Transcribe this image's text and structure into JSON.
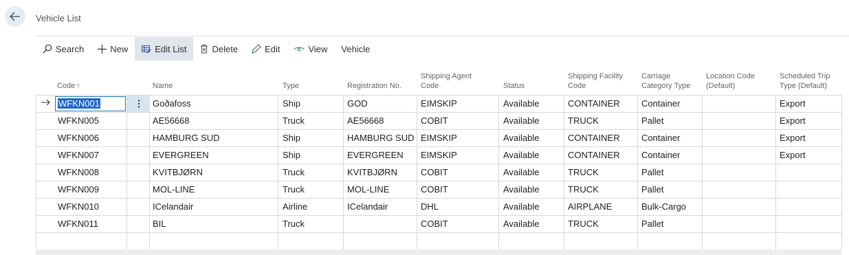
{
  "page": {
    "title": "Vehicle List"
  },
  "toolbar": {
    "search": "Search",
    "new": "New",
    "edit_list": "Edit List",
    "delete": "Delete",
    "edit": "Edit",
    "view": "View",
    "vehicle": "Vehicle"
  },
  "columns": {
    "code": "Code",
    "name": "Name",
    "type": "Type",
    "registration": "Registration No.",
    "agent_1": "Shipping Agent",
    "agent_2": "Code",
    "status": "Status",
    "facility_1": "Shipping Facility",
    "facility_2": "Code",
    "carriage_1": "Carriage",
    "carriage_2": "Category Type",
    "location_1": "Location Code",
    "location_2": "(Default)",
    "trip_1": "Scheduled Trip",
    "trip_2": "Type (Default)"
  },
  "sort_indicator": "↑",
  "rows": [
    {
      "code": "WFKN001",
      "name": "Goðafoss",
      "type": "Ship",
      "reg": "GOD",
      "agent": "EIMSKIP",
      "status": "Available",
      "facility": "CONTAINER",
      "carriage": "Container",
      "location": "",
      "trip": "Export"
    },
    {
      "code": "WFKN005",
      "name": "AE56668",
      "type": "Truck",
      "reg": "AE56668",
      "agent": "COBIT",
      "status": "Available",
      "facility": "TRUCK",
      "carriage": "Pallet",
      "location": "",
      "trip": "Export"
    },
    {
      "code": "WFKN006",
      "name": "HAMBURG SUD",
      "type": "Ship",
      "reg": "HAMBURG SUD",
      "agent": "EIMSKIP",
      "status": "Available",
      "facility": "CONTAINER",
      "carriage": "Container",
      "location": "",
      "trip": "Export"
    },
    {
      "code": "WFKN007",
      "name": "EVERGREEN",
      "type": "Ship",
      "reg": "EVERGREEN",
      "agent": "EIMSKIP",
      "status": "Available",
      "facility": "CONTAINER",
      "carriage": "Container",
      "location": "",
      "trip": "Export"
    },
    {
      "code": "WFKN008",
      "name": "KVITBJØRN",
      "type": "Truck",
      "reg": "KVITBJØRN",
      "agent": "COBIT",
      "status": "Available",
      "facility": "TRUCK",
      "carriage": "Pallet",
      "location": "",
      "trip": ""
    },
    {
      "code": "WFKN009",
      "name": "MOL-LINE",
      "type": "Truck",
      "reg": "MOL-LINE",
      "agent": "COBIT",
      "status": "Available",
      "facility": "TRUCK",
      "carriage": "Pallet",
      "location": "",
      "trip": ""
    },
    {
      "code": "WFKN010",
      "name": "ICelandair",
      "type": "Airline",
      "reg": "ICelandair",
      "agent": "DHL",
      "status": "Available",
      "facility": "AIRPLANE",
      "carriage": "Bulk-Cargo",
      "location": "",
      "trip": ""
    },
    {
      "code": "WFKN011",
      "name": "BIL",
      "type": "Truck",
      "reg": "",
      "agent": "COBIT",
      "status": "Available",
      "facility": "TRUCK",
      "carriage": "Pallet",
      "location": "",
      "trip": ""
    }
  ]
}
